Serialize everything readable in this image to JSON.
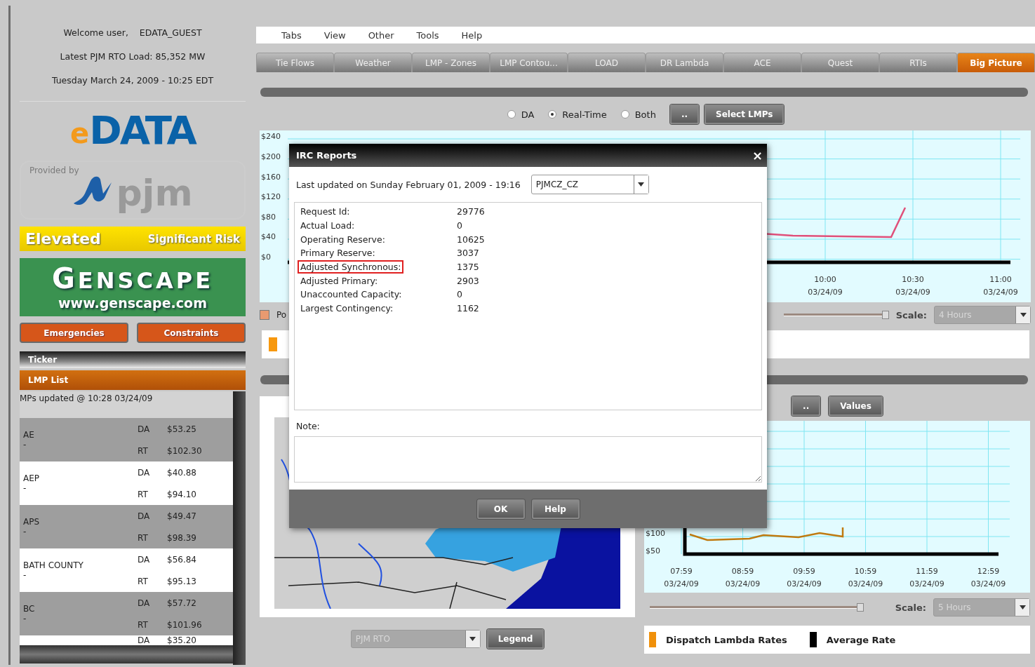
{
  "header": {
    "welcome_label": "Welcome user,",
    "username": "EDATA_GUEST",
    "load": "Latest PJM RTO Load: 85,352 MW",
    "datetime": "Tuesday March 24, 2009 - 10:25 EDT"
  },
  "edata_logo": {
    "prefix": "e",
    "word": "DATA"
  },
  "pjm_logo": {
    "provided_by": "Provided by",
    "word": "pjm"
  },
  "alert": {
    "level": "Elevated",
    "risk": "Significant Risk"
  },
  "sponsor": {
    "name": "GENSCAPE",
    "url": "www.genscape.com"
  },
  "left_buttons": [
    "Emergencies",
    "Constraints"
  ],
  "ticker": {
    "title": "Ticker"
  },
  "lmp_list": {
    "title": "LMP List",
    "updated": "MPs updated @ 10:28 03/24/09",
    "rows": [
      {
        "name": "AE",
        "sub": "-",
        "da_label": "DA",
        "da": "$53.25",
        "rt_label": "RT",
        "rt": "$102.30"
      },
      {
        "name": "AEP",
        "sub": "-",
        "da_label": "DA",
        "da": "$40.88",
        "rt_label": "RT",
        "rt": "$94.10"
      },
      {
        "name": "APS",
        "sub": "-",
        "da_label": "DA",
        "da": "$49.47",
        "rt_label": "RT",
        "rt": "$98.39"
      },
      {
        "name": "BATH COUNTY",
        "sub": "-",
        "da_label": "DA",
        "da": "$56.84",
        "rt_label": "RT",
        "rt": "$95.13"
      },
      {
        "name": "BC",
        "sub": "-",
        "da_label": "DA",
        "da": "$57.72",
        "rt_label": "RT",
        "rt": "$101.96"
      },
      {
        "da_label": "DA",
        "da": "$35.20"
      }
    ]
  },
  "menu": [
    "Tabs",
    "View",
    "Other",
    "Tools",
    "Help"
  ],
  "tabs": [
    {
      "label": "Tie Flows",
      "selected": false
    },
    {
      "label": "Weather",
      "selected": false
    },
    {
      "label": "LMP - Zones",
      "selected": false
    },
    {
      "label": "LMP Contou...",
      "selected": false
    },
    {
      "label": "LOAD",
      "selected": false
    },
    {
      "label": "DR Lambda",
      "selected": false
    },
    {
      "label": "ACE",
      "selected": false
    },
    {
      "label": "Quest",
      "selected": false
    },
    {
      "label": "RTIs",
      "selected": false
    },
    {
      "label": "Big Picture",
      "selected": true
    }
  ],
  "price_panel": {
    "modes": [
      {
        "label": "DA",
        "selected": false
      },
      {
        "label": "Real-Time",
        "selected": true
      },
      {
        "label": "Both",
        "selected": false
      }
    ],
    "buttons": [
      "..",
      "Select LMPs"
    ],
    "chart": {
      "yticks": [
        "$240",
        "$200",
        "$160",
        "$120",
        "$80",
        "$40",
        "$0"
      ],
      "xticks": [
        {
          "time": "10:00",
          "date": "03/24/09"
        },
        {
          "time": "10:30",
          "date": "03/24/09"
        },
        {
          "time": "11:00",
          "date": "03/24/09"
        }
      ]
    },
    "legend_partial": "Po",
    "slider": {
      "level": 1
    },
    "scale": {
      "label": "Scale:",
      "value": "4 Hours",
      "disabled": true
    }
  },
  "map_panel": {
    "region": {
      "value": "PJM RTO",
      "disabled": true
    },
    "button": "Legend"
  },
  "lambda_panel": {
    "buttons": [
      "..",
      "Values"
    ],
    "chart": {
      "yticks": [
        "$100",
        "$50"
      ],
      "xticks": [
        {
          "time": "07:59",
          "date": "03/24/09"
        },
        {
          "time": "08:59",
          "date": "03/24/09"
        },
        {
          "time": "09:59",
          "date": "03/24/09"
        },
        {
          "time": "10:59",
          "date": "03/24/09"
        },
        {
          "time": "11:59",
          "date": "03/24/09"
        },
        {
          "time": "12:59",
          "date": "03/24/09"
        }
      ]
    },
    "slider": {
      "level": 1
    },
    "scale": {
      "label": "Scale:",
      "value": "5 Hours",
      "disabled": true
    },
    "legend": [
      {
        "label": "Dispatch Lambda Rates",
        "color": "#f0900a"
      },
      {
        "label": "Average Rate",
        "color": "#000000"
      }
    ]
  },
  "dialog": {
    "title": "IRC Reports",
    "close": "×",
    "last_updated": "Last updated on Sunday February 01, 2009 - 19:16",
    "zone": "PJMCZ_CZ",
    "fields": [
      {
        "label": "Request Id:",
        "value": "29776",
        "highlighted": false
      },
      {
        "label": "Actual Load:",
        "value": "0",
        "highlighted": false
      },
      {
        "label": "Operating Reserve:",
        "value": "10625",
        "highlighted": false
      },
      {
        "label": "Primary Reserve:",
        "value": "3037",
        "highlighted": false
      },
      {
        "label": "Adjusted Synchronous:",
        "value": "1375",
        "highlighted": true
      },
      {
        "label": "Adjusted Primary:",
        "value": "2903",
        "highlighted": false
      },
      {
        "label": "Unaccounted Capacity:",
        "value": "0",
        "highlighted": false
      },
      {
        "label": "Largest Contingency:",
        "value": "1162",
        "highlighted": false
      }
    ],
    "note_label": "Note:",
    "buttons": [
      "OK",
      "Help"
    ]
  }
}
